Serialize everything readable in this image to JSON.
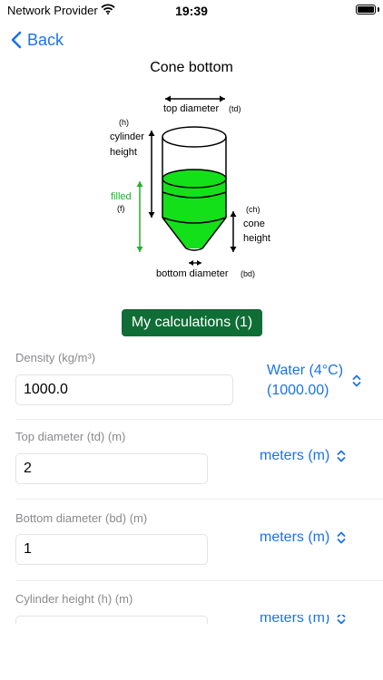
{
  "status_bar": {
    "carrier": "Network Provider",
    "time": "19:39"
  },
  "nav": {
    "back_label": "Back"
  },
  "page": {
    "title": "Cone bottom"
  },
  "diagram": {
    "top_diameter": "top diameter",
    "top_diameter_abbr": "(td)",
    "h_abbr": "(h)",
    "cylinder": "cylinder",
    "height": "height",
    "filled": "filled",
    "f_abbr": "(f)",
    "ch_abbr": "(ch)",
    "cone": "cone",
    "cone_height_word": "height",
    "bottom_diameter": "bottom diameter",
    "bottom_diameter_abbr": "(bd)",
    "fill_color": "#14e01a"
  },
  "calculations_button": "My calculations (1)",
  "fields": [
    {
      "label": "Density (kg/m³)",
      "value": "1000.0",
      "unit": "Water (4°C)",
      "unit_line2": "(1000.00)"
    },
    {
      "label": "Top diameter (td) (m)",
      "value": "2",
      "unit": "meters (m)"
    },
    {
      "label": "Bottom diameter (bd) (m)",
      "value": "1",
      "unit": "meters (m)"
    },
    {
      "label": "Cylinder height (h) (m)",
      "value": "",
      "unit": "meters (m)"
    }
  ]
}
